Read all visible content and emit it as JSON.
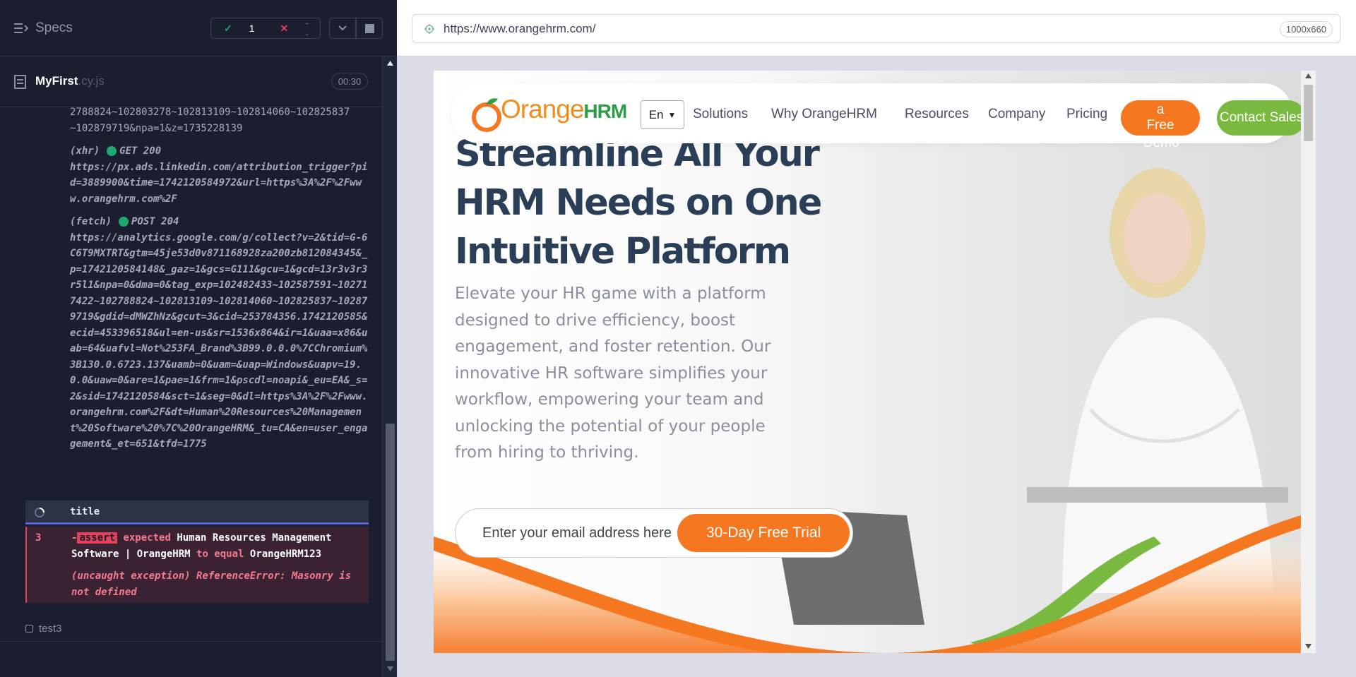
{
  "runner": {
    "specs_label": "Specs",
    "passed_count": "1",
    "failed_count": "--",
    "pending_count": "--",
    "spec_file": {
      "name": "MyFirst",
      "ext": ".cy.js",
      "duration": "00:30"
    },
    "log": {
      "partial_line_1": "2788824~102803278~102813109~102814060~102825837",
      "partial_line_2": "~102879719&npa=1&z=1735228139",
      "xhr_tag": "(xhr)",
      "xhr_method": "GET 200",
      "xhr_url": "https://px.ads.linkedin.com/attribution_trigger?pid=3889900&time=1742120584972&url=https%3A%2F%2Fwww.orangehrm.com%2F",
      "fetch_tag": "(fetch)",
      "fetch_method": "POST 204",
      "fetch_url": "https://analytics.google.com/g/collect?v=2&tid=G-6C6T9MXTRT&gtm=45je53d0v871168928za200zb812084345&_p=1742120584148&_gaz=1&gcs=G111&gcu=1&gcd=13r3v3r3r5l1&npa=0&dma=0&tag_exp=102482433~102587591~102717422~102788824~102813109~102814060~102825837~102879719&gdid=dMWZhNz&gcut=3&cid=253784356.1742120585&ecid=453396518&ul=en-us&sr=1536x864&ir=1&uaa=x86&uab=64&uafvl=Not%253FA_Brand%3B99.0.0.0%7CChromium%3B130.0.6723.137&uamb=0&uam=&uap=Windows&uapv=19.0.0&uaw=0&are=1&pae=1&frm=1&pscdl=noapi&_eu=EA&_s=2&sid=1742120584&sct=1&seg=0&dl=https%3A%2F%2Fwww.orangehrm.com%2F&dt=Human%20Resources%20Management%20Software%20%7C%20OrangeHRM&_tu=CA&en=user_engagement&_et=651&tfd=1775"
    },
    "current_command": "title",
    "error": {
      "line_no": "3",
      "dash": "-",
      "assert_badge": "assert",
      "expected_word": "expected",
      "actual_value": "Human Resources Management Software | OrangeHRM",
      "to_equal": "to equal",
      "expected_value": "OrangeHRM123",
      "uncaught_tag": "(uncaught exception)",
      "uncaught_msg": "ReferenceError: Masonry is not defined"
    },
    "next_test": "test3"
  },
  "browser": {
    "url": "https://www.orangehrm.com/",
    "viewport": "1000x660"
  },
  "site": {
    "logo_main": "Orange",
    "logo_hrm": "HRM",
    "lang": "En",
    "nav": [
      "Solutions",
      "Why OrangeHRM",
      "Resources",
      "Company",
      "Pricing"
    ],
    "book_demo_btn": "a\nFree",
    "book_demo_overflow": "Demo",
    "contact_btn": "Contact Sales",
    "headline": "Streamline All Your HRM Needs on One Intuitive Platform",
    "subtext": "Elevate your HR game with a platform designed to drive efficiency, boost engagement, and foster retention. Our innovative HR software simplifies your workflow, empowering your team and unlocking the potential of your people from hiring to thriving.",
    "email_placeholder": "Enter your email address here",
    "trial_btn": "30-Day Free Trial"
  },
  "colors": {
    "runner_bg": "#1b1e2e",
    "pass": "#1fa971",
    "fail": "#e0425c",
    "orange": "#f5771f",
    "green": "#7ab940",
    "navy": "#2a3f57"
  }
}
